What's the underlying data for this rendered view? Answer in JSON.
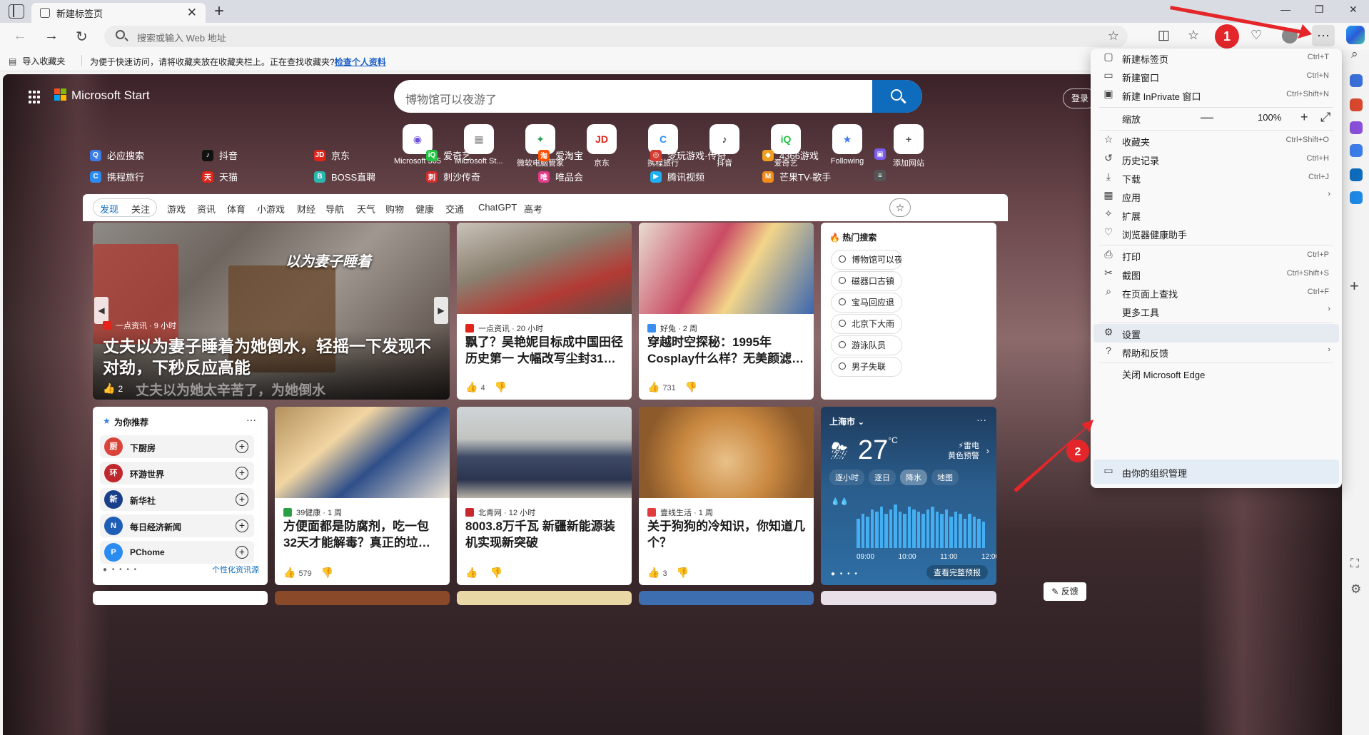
{
  "browser": {
    "tab_title": "新建标签页",
    "tab_close": "✕",
    "new_tab": "+",
    "window_controls": [
      "—",
      "❐",
      "✕"
    ],
    "address_placeholder": "搜索或输入 Web 地址",
    "more_label": "···",
    "annotations": [
      "1",
      "2"
    ]
  },
  "favorites_bar": {
    "import_label": "导入收藏夹",
    "hint": "为便于快速访问，请将收藏夹放在收藏夹栏上。正在查找收藏夹?",
    "hint_link": "检查个人资料"
  },
  "start": {
    "brand": "Microsoft Start",
    "search_placeholder": "博物馆可以夜游了",
    "login": "登录",
    "quick_links": [
      {
        "label": "Microsoft 365",
        "glyph": "◉",
        "color": "#6b4fd8"
      },
      {
        "label": "Microsoft St...",
        "glyph": "▦",
        "color": "#888888"
      },
      {
        "label": "微软电脑管家",
        "glyph": "✦",
        "color": "#2fa04a"
      },
      {
        "label": "京东",
        "glyph": "JD",
        "color": "#e1251b"
      },
      {
        "label": "携程旅行",
        "glyph": "C",
        "color": "#2a8cf0"
      },
      {
        "label": "抖音",
        "glyph": "♪",
        "color": "#111111"
      },
      {
        "label": "爱奇艺",
        "glyph": "iQ",
        "color": "#23c343"
      },
      {
        "label": "Following",
        "glyph": "★",
        "color": "#3a7bf0"
      },
      {
        "label": "添加网站",
        "glyph": "+",
        "color": "#555555"
      }
    ],
    "hot_links_row1": [
      {
        "label": "必应搜索",
        "color": "#3b7ce8",
        "glyph": "Q"
      },
      {
        "label": "抖音",
        "color": "#111111",
        "glyph": "♪"
      },
      {
        "label": "京东",
        "color": "#e1251b",
        "glyph": "JD"
      },
      {
        "label": "爱奇艺",
        "color": "#23c343",
        "glyph": "iQ"
      },
      {
        "label": "爱淘宝",
        "color": "#ff5000",
        "glyph": "淘"
      },
      {
        "label": "梦玩游戏·传奇",
        "color": "#d43a2f",
        "glyph": "◎"
      },
      {
        "label": "4366游戏",
        "color": "#f0a020",
        "glyph": "◆"
      },
      {
        "label": "",
        "color": "#7b5cf0",
        "glyph": "▣"
      }
    ],
    "hot_links_row2": [
      {
        "label": "携程旅行",
        "color": "#2a8cf0",
        "glyph": "C"
      },
      {
        "label": "天猫",
        "color": "#e1251b",
        "glyph": "天"
      },
      {
        "label": "BOSS直聘",
        "color": "#2ab7b0",
        "glyph": "B"
      },
      {
        "label": "刺沙传奇",
        "color": "#d42c2c",
        "glyph": "刺"
      },
      {
        "label": "唯品会",
        "color": "#e33a8a",
        "glyph": "唯"
      },
      {
        "label": "腾讯视频",
        "color": "#1eb0f0",
        "glyph": "▶"
      },
      {
        "label": "芒果TV-歌手",
        "color": "#f28c1b",
        "glyph": "M"
      },
      {
        "label": "",
        "color": "#555555",
        "glyph": "≡"
      }
    ],
    "feed_tabs": [
      "发现",
      "关注",
      "游戏",
      "资讯",
      "体育",
      "小游戏",
      "财经",
      "导航",
      "天气",
      "购物",
      "健康",
      "交通",
      "ChatGPT",
      "高考"
    ]
  },
  "cards": {
    "hero": {
      "overlay_text": "以为妻子睡着",
      "source": "一点资讯 · 9 小时",
      "title": "丈夫以为妻子睡着为她倒水，轻摇一下发现不对劲，下秒反应高能",
      "subtitle": "丈夫以为她太辛苦了，为她倒水",
      "likes": "2",
      "arrow_left": "◀",
      "arrow_right": "▶"
    },
    "c2": {
      "source": "一点资讯 · 20 小时",
      "title": "飘了？吴艳妮目标成中国田径历史第一 大幅改写尘封31年…",
      "likes": "4"
    },
    "c3": {
      "source": "好兔 · 2 周",
      "title": "穿越时空探秘：1995年Cosplay什么样？无美颜滤镜…",
      "likes": "731"
    },
    "hot": {
      "title": "热门搜索",
      "items": [
        "博物馆可以夜游了",
        "磁器口古镇",
        "宝马回应退",
        "北京下大雨",
        "游泳队员",
        "男子失联"
      ]
    },
    "rec": {
      "title": "为你推荐",
      "more": "···",
      "items": [
        {
          "name": "下厨房",
          "color": "#d9433a",
          "glyph": "厨"
        },
        {
          "name": "环游世界",
          "color": "#c0282d",
          "glyph": "环"
        },
        {
          "name": "新华社",
          "color": "#1a3f8a",
          "glyph": "新"
        },
        {
          "name": "每日经济新闻",
          "color": "#1e5eb5",
          "glyph": "N"
        },
        {
          "name": "PChome",
          "color": "#2a8cf0",
          "glyph": "P"
        }
      ],
      "footer_link": "个性化资讯源",
      "add": "+"
    },
    "c5": {
      "source": "39健康 · 1 周",
      "title": "方便面都是防腐剂，吃一包32天才能解毒？真正的垃圾食…",
      "likes": "579"
    },
    "c6": {
      "source": "北青网 · 12 小时",
      "title": "8003.8万千瓦 新疆新能源装机实现新突破",
      "likes": ""
    },
    "c7": {
      "source": "壹线生活 · 1 周",
      "title": "关于狗狗的冷知识，你知道几个？",
      "likes": "3"
    },
    "weather": {
      "location": "上海市",
      "temp": "27",
      "unit": "°C",
      "alert_line1": "雷电",
      "alert_line2": "黄色预警",
      "tabs": [
        "逐小时",
        "逐日",
        "降水",
        "地图"
      ],
      "active_tab": "降水",
      "times": [
        "09:00",
        "10:00",
        "11:00",
        "12:00"
      ],
      "full_forecast": "查看完整预报",
      "precip_bars": [
        0.6,
        0.7,
        0.65,
        0.8,
        0.75,
        0.85,
        0.7,
        0.8,
        0.9,
        0.75,
        0.7,
        0.85,
        0.8,
        0.75,
        0.7,
        0.8,
        0.85,
        0.75,
        0.7,
        0.8,
        0.65,
        0.75,
        0.7,
        0.6,
        0.7,
        0.65,
        0.6,
        0.55
      ]
    },
    "feedback": "反馈"
  },
  "menu": {
    "items": [
      {
        "icon": "▢",
        "label": "新建标签页",
        "shortcut": "Ctrl+T"
      },
      {
        "icon": "▭",
        "label": "新建窗口",
        "shortcut": "Ctrl+N"
      },
      {
        "icon": "▣",
        "label": "新建 InPrivate 窗口",
        "shortcut": "Ctrl+Shift+N"
      },
      {
        "label": "缩放",
        "zoom": "100%",
        "minus": "—",
        "plus": "+",
        "full": "⤢"
      },
      {
        "icon": "☆",
        "label": "收藏夹",
        "shortcut": "Ctrl+Shift+O"
      },
      {
        "icon": "↺",
        "label": "历史记录",
        "shortcut": "Ctrl+H"
      },
      {
        "icon": "⤓",
        "label": "下载",
        "shortcut": "Ctrl+J"
      },
      {
        "icon": "▦",
        "label": "应用",
        "arrow": "›"
      },
      {
        "icon": "✧",
        "label": "扩展"
      },
      {
        "icon": "♡",
        "label": "浏览器健康助手"
      },
      {
        "icon": "⎙",
        "label": "打印",
        "shortcut": "Ctrl+P"
      },
      {
        "icon": "✂",
        "label": "截图",
        "shortcut": "Ctrl+Shift+S"
      },
      {
        "icon": "⌕",
        "label": "在页面上查找",
        "shortcut": "Ctrl+F"
      },
      {
        "label": "更多工具",
        "arrow": "›"
      },
      {
        "icon": "⚙",
        "label": "设置"
      },
      {
        "icon": "?",
        "label": "帮助和反馈",
        "arrow": "›"
      },
      {
        "label": "关闭 Microsoft Edge"
      },
      {
        "icon": "▭",
        "label": "由你的组织管理"
      }
    ]
  }
}
